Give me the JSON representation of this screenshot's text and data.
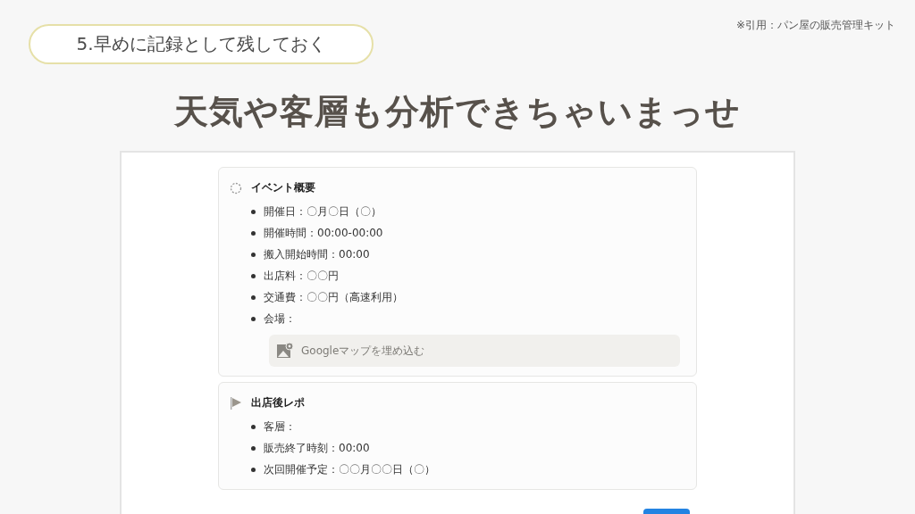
{
  "section_label": "5.早めに記録として残しておく",
  "source_note": "※引用：パン屋の販売管理キット",
  "headline": "天気や客層も分析できちゃいまっせ",
  "callouts": [
    {
      "kind": "event",
      "title": "イベント概要",
      "items": [
        "開催日：〇月〇日（〇）",
        "開催時間：00:00-00:00",
        "搬入開始時間：00:00",
        "出店料：〇〇円",
        "交通費：〇〇円（高速利用）",
        "会場："
      ],
      "embed": {
        "placeholder": "Googleマップを埋め込む"
      }
    },
    {
      "kind": "report",
      "title": "出店後レポ",
      "items": [
        "客層：",
        "販売終了時刻：00:00",
        "次回開催予定：〇〇月〇〇日（〇）"
      ]
    }
  ]
}
